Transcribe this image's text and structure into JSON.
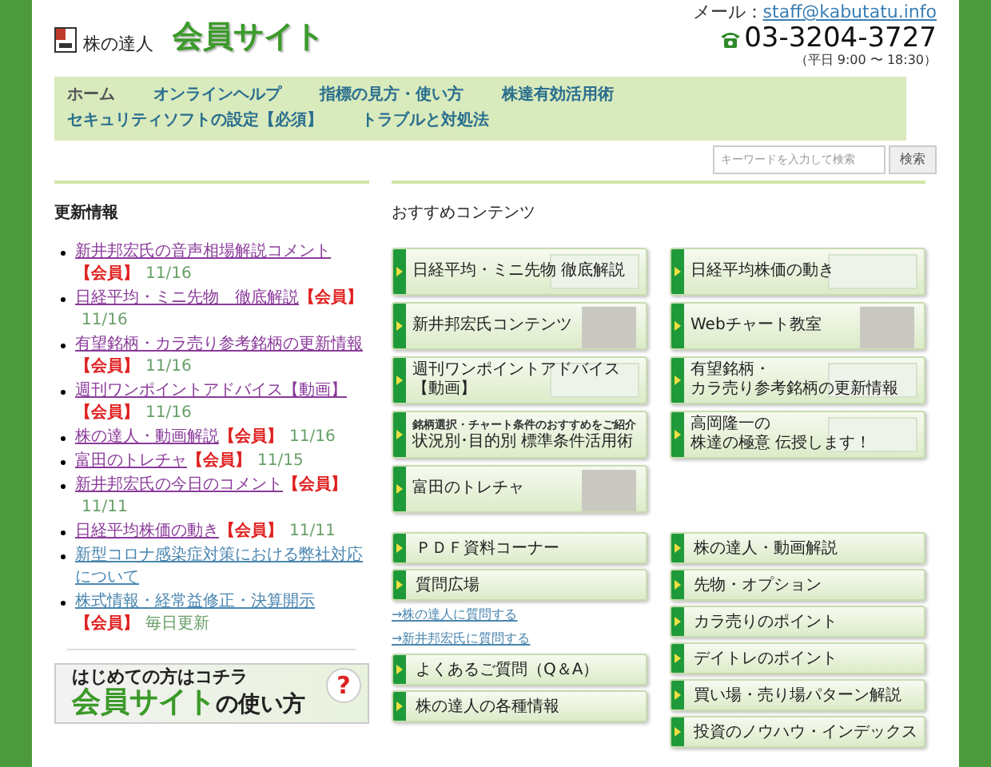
{
  "header": {
    "logo_text": "株の達人",
    "site_title": "会員サイト",
    "mail_label": "メール：",
    "mail_link": "staff@kabutatu.info",
    "phone": "03-3204-3727",
    "hours": "（平日 9:00 〜 18:30）"
  },
  "nav": [
    {
      "label": "ホーム",
      "selected": true
    },
    {
      "label": "オンラインヘルプ",
      "selected": false
    },
    {
      "label": "指標の見方・使い方",
      "selected": false
    },
    {
      "label": "株達有効活用術",
      "selected": false
    },
    {
      "label": "セキュリティソフトの設定【必須】",
      "selected": false
    },
    {
      "label": "トラブルと対処法",
      "selected": false
    }
  ],
  "search": {
    "placeholder": "キーワードを入力して検索",
    "button": "検索"
  },
  "updates": {
    "heading": "更新情報",
    "items": [
      {
        "title": "新井邦宏氏の音声相場解説コメント",
        "tag": "【会員】",
        "date": "11/16",
        "visited": true
      },
      {
        "title": "日経平均・ミニ先物　徹底解説",
        "tag": "【会員】",
        "date": "11/16",
        "visited": true
      },
      {
        "title": "有望銘柄・カラ売り参考銘柄の更新情報",
        "tag": "【会員】",
        "date": "11/16",
        "visited": true
      },
      {
        "title": "週刊ワンポイントアドバイス【動画】",
        "tag": "【会員】",
        "date": "11/16",
        "visited": true
      },
      {
        "title": "株の達人・動画解説",
        "tag": "【会員】",
        "date": "11/16",
        "visited": true
      },
      {
        "title": "富田のトレチャ",
        "tag": "【会員】",
        "date": "11/15",
        "visited": true
      },
      {
        "title": "新井邦宏氏の今日のコメント",
        "tag": "【会員】",
        "date": "11/11",
        "visited": true
      },
      {
        "title": "日経平均株価の動き",
        "tag": "【会員】",
        "date": "11/11",
        "visited": true
      },
      {
        "title": "新型コロナ感染症対策における弊社対応について",
        "visited": false
      },
      {
        "title": "株式情報・経常益修正・決算開示",
        "tag": "【会員】",
        "date": "毎日更新",
        "visited": false
      }
    ]
  },
  "guide_banner": {
    "line_1": "はじめての方はコチラ",
    "line_2a": "会員サイト",
    "line_2b": "の使い方",
    "mark": "?"
  },
  "recommended": {
    "heading": "おすすめコンテンツ",
    "tiles": [
      {
        "lines": [
          "日経平均・ミニ先物 徹底解説"
        ],
        "kind": "chart"
      },
      {
        "lines": [
          "日経平均株価の動き"
        ],
        "kind": "chart"
      },
      {
        "lines": [
          "新井邦宏氏コンテンツ"
        ],
        "kind": "photo"
      },
      {
        "lines": [
          "Webチャート教室"
        ],
        "kind": "photo"
      },
      {
        "lines": [
          "週刊ワンポイントアドバイス",
          "【動画】"
        ],
        "kind": "chart"
      },
      {
        "lines": [
          "有望銘柄・",
          "カラ売り参考銘柄の更新情報"
        ],
        "kind": "chart"
      },
      {
        "kicker": "銘柄選択・チャート条件のおすすめをご紹介",
        "lines": [
          "状況別･目的別 標準条件活用術"
        ],
        "kind": "plain"
      },
      {
        "lines": [
          "高岡隆一の",
          "株達の極意 伝授します！"
        ],
        "kind": "chart"
      },
      {
        "lines": [
          "富田のトレチャ"
        ],
        "kind": "photo"
      }
    ]
  },
  "left_menu": [
    {
      "kind": "button",
      "label": "ＰＤＦ資料コーナー"
    },
    {
      "kind": "button",
      "label": "質問広場"
    },
    {
      "kind": "link",
      "label": "→株の達人に質問する"
    },
    {
      "kind": "link",
      "label": "→新井邦宏氏に質問する"
    },
    {
      "kind": "button",
      "label": "よくあるご質問（Q＆A）"
    },
    {
      "kind": "button",
      "label": "株の達人の各種情報"
    }
  ],
  "right_menu": [
    {
      "kind": "button",
      "label": "株の達人・動画解説"
    },
    {
      "kind": "button",
      "label": "先物・オプション"
    },
    {
      "kind": "button",
      "label": "カラ売りのポイント"
    },
    {
      "kind": "button",
      "label": "デイトレのポイント"
    },
    {
      "kind": "button",
      "label": "買い場・売り場パターン解説"
    },
    {
      "kind": "button",
      "label": "投資のノウハウ・インデックス"
    }
  ]
}
